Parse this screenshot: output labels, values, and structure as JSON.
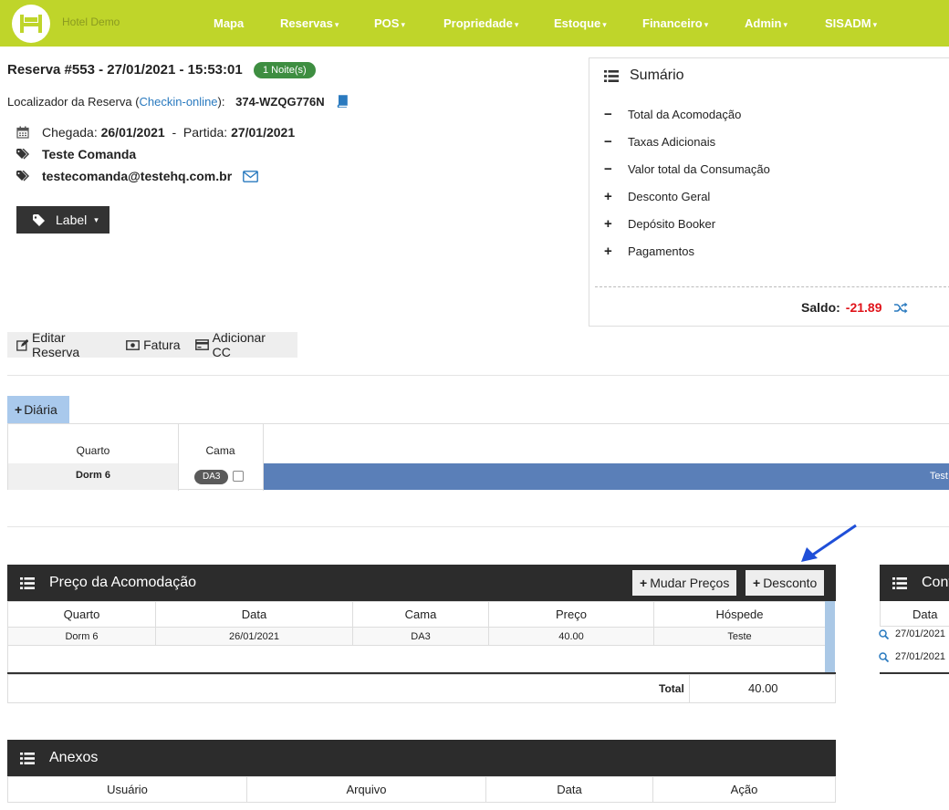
{
  "nav": {
    "brand": "Hotel Demo",
    "items": [
      {
        "label": "Mapa",
        "dropdown": false
      },
      {
        "label": "Reservas",
        "dropdown": true
      },
      {
        "label": "POS",
        "dropdown": true
      },
      {
        "label": "Propriedade",
        "dropdown": true
      },
      {
        "label": "Estoque",
        "dropdown": true
      },
      {
        "label": "Financeiro",
        "dropdown": true
      },
      {
        "label": "Admin",
        "dropdown": true
      },
      {
        "label": "SISADM",
        "dropdown": true
      }
    ],
    "caret": "▾"
  },
  "reservation": {
    "title": "Reserva #553 - 27/01/2021 - 15:53:01",
    "nights_badge": "1 Noite(s)",
    "locator_prefix": "Localizador da Reserva (",
    "locator_link": "Checkin-online",
    "locator_suffix": "):",
    "locator_code": "374-WZQG776N",
    "arrival_label": "Chegada:",
    "arrival_date": "26/01/2021",
    "separator": "-",
    "departure_label": "Partida:",
    "departure_date": "27/01/2021",
    "guest_name": "Teste Comanda",
    "guest_email": "testecomanda@testehq.com.br",
    "label_button": "Label"
  },
  "summary": {
    "title": "Sumário",
    "items": [
      {
        "symbol": "−",
        "label": "Total da Acomodação"
      },
      {
        "symbol": "−",
        "label": "Taxas Adicionais"
      },
      {
        "symbol": "−",
        "label": "Valor total da Consumação"
      },
      {
        "symbol": "+",
        "label": "Desconto Geral"
      },
      {
        "symbol": "+",
        "label": "Depósito Booker"
      },
      {
        "symbol": "+",
        "label": "Pagamentos"
      }
    ],
    "saldo_label": "Saldo:",
    "saldo_value": "-21.89"
  },
  "actions": {
    "edit": "Editar Reserva",
    "invoice": "Fatura",
    "add_cc": "Adicionar CC"
  },
  "diaria": {
    "tab_plus": "+",
    "tab_label": "Diária",
    "col_room": "Quarto",
    "col_bed": "Cama",
    "room": "Dorm 6",
    "bed": "DA3",
    "guest_bar": "Test"
  },
  "price": {
    "title": "Preço da Acomodação",
    "btn_change": "Mudar Preços",
    "btn_discount": "Desconto",
    "plus": "+",
    "columns": [
      "Quarto",
      "Data",
      "Cama",
      "Preço",
      "Hóspede"
    ],
    "rows": [
      [
        "Dorm 6",
        "26/01/2021",
        "DA3",
        "40.00",
        "Teste"
      ]
    ],
    "total_label": "Total",
    "total_value": "40.00"
  },
  "side_panel": {
    "title": "Cont",
    "col_date": "Data",
    "rows": [
      "27/01/2021",
      "27/01/2021"
    ]
  },
  "attachments": {
    "title": "Anexos",
    "columns": [
      "Usuário",
      "Arquivo",
      "Data",
      "Ação"
    ]
  },
  "colors": {
    "nav_bg": "#bfd52a",
    "saldo_negative": "#e0141b",
    "link": "#2a7abf",
    "panel_head": "#2c2c2c",
    "guest_bar": "#5a7fb8",
    "badge_green": "#3e8e41"
  }
}
